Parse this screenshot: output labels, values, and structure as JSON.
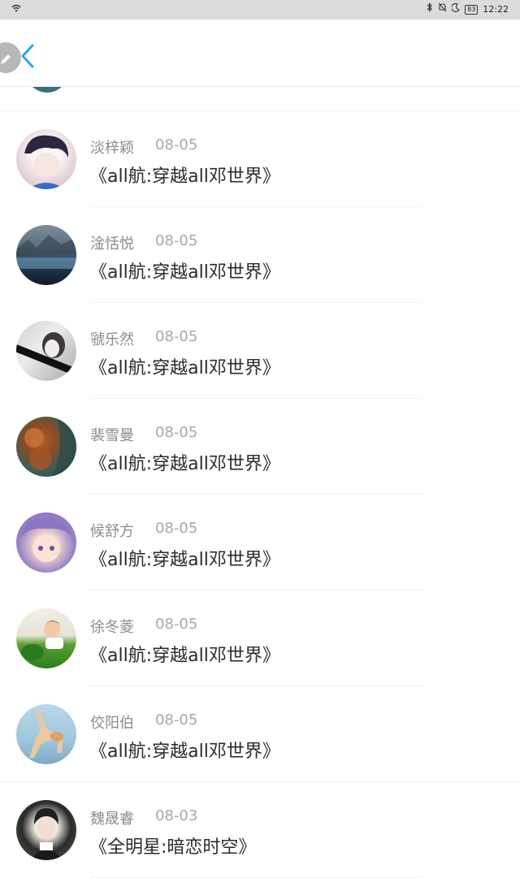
{
  "status_bar": {
    "battery": "83",
    "time": "12:22",
    "icons": [
      "wifi-icon",
      "bluetooth-icon",
      "mute-icon",
      "moon-icon"
    ]
  },
  "header": {
    "back_icon": "chevron-left-icon",
    "edit_icon": "pencil-icon",
    "accent_color": "#2aa6e6"
  },
  "comments": [
    {
      "user": "淡梓颖",
      "date": "08-05",
      "book": "《all航:穿越all邓世界》"
    },
    {
      "user": "淦恬悦",
      "date": "08-05",
      "book": "《all航:穿越all邓世界》"
    },
    {
      "user": "虢乐然",
      "date": "08-05",
      "book": "《all航:穿越all邓世界》"
    },
    {
      "user": "裴雪曼",
      "date": "08-05",
      "book": "《all航:穿越all邓世界》"
    },
    {
      "user": "候舒方",
      "date": "08-05",
      "book": "《all航:穿越all邓世界》"
    },
    {
      "user": "徐冬菱",
      "date": "08-05",
      "book": "《all航:穿越all邓世界》"
    },
    {
      "user": "佼阳伯",
      "date": "08-05",
      "book": "《all航:穿越all邓世界》"
    },
    {
      "user": "魏晟睿",
      "date": "08-03",
      "book": "《全明星:暗恋时空》"
    }
  ]
}
